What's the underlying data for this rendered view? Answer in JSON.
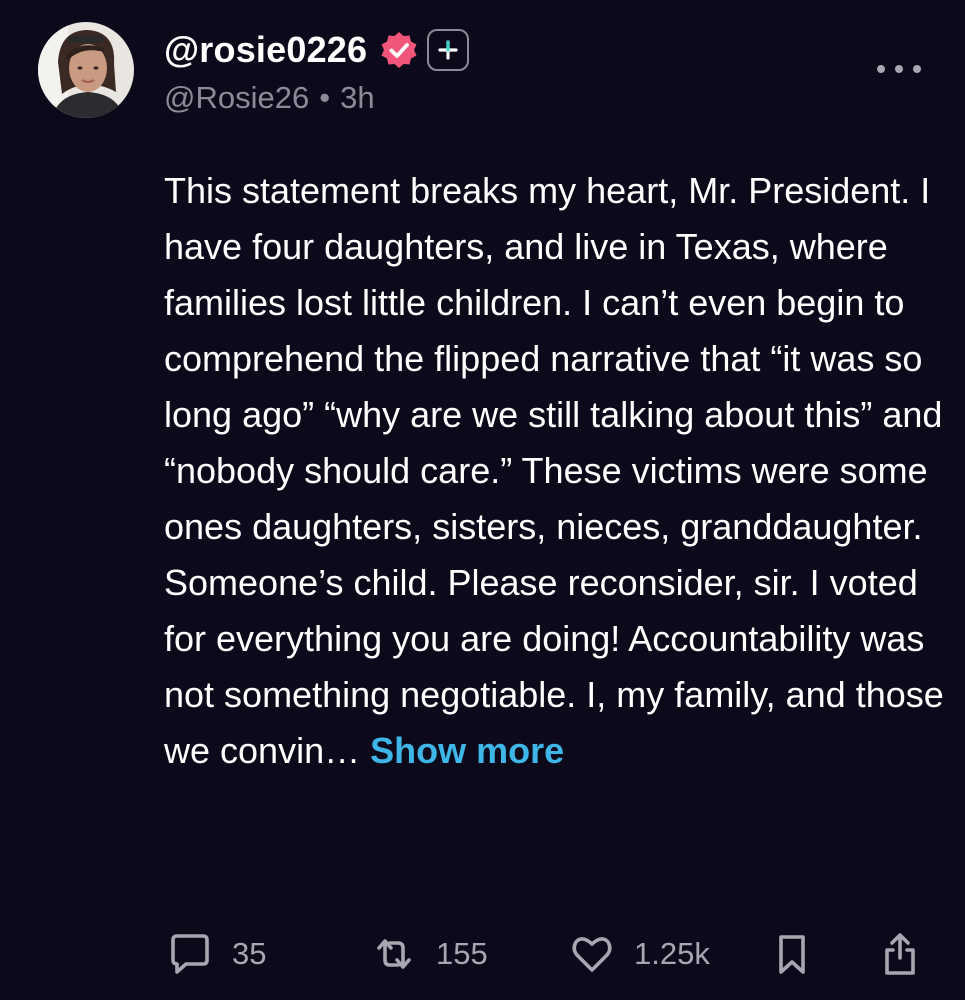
{
  "post": {
    "display_name": "@rosie0226",
    "handle": "@Rosie26",
    "separator": "•",
    "time": "3h",
    "body": "This statement breaks my heart, Mr. President. I have four daughters, and live in Texas, where families lost little children. I can’t even begin to comprehend the flipped narrative that “it was so long ago” “why are we still talking about this” and “nobody should care.” These victims were some ones daughters, sisters, nieces, granddaughter. Someone’s child. Please reconsider, sir. I voted for everything you are doing! Accountability was not something negotiable. I, my family, and those we convin… ",
    "show_more_label": "Show more"
  },
  "actions": {
    "comments": "35",
    "reposts": "155",
    "likes": "1.25k"
  },
  "icons": {
    "verified": "verified-badge-icon",
    "follow": "plus-icon",
    "more": "ellipsis-icon",
    "comment": "comment-icon",
    "repost": "repost-icon",
    "like": "heart-icon",
    "bookmark": "bookmark-icon",
    "share": "share-icon"
  },
  "colors": {
    "background": "#0c0a1a",
    "verified": "#f2557a",
    "link": "#3fb6e8",
    "muted": "#8b8b98"
  }
}
